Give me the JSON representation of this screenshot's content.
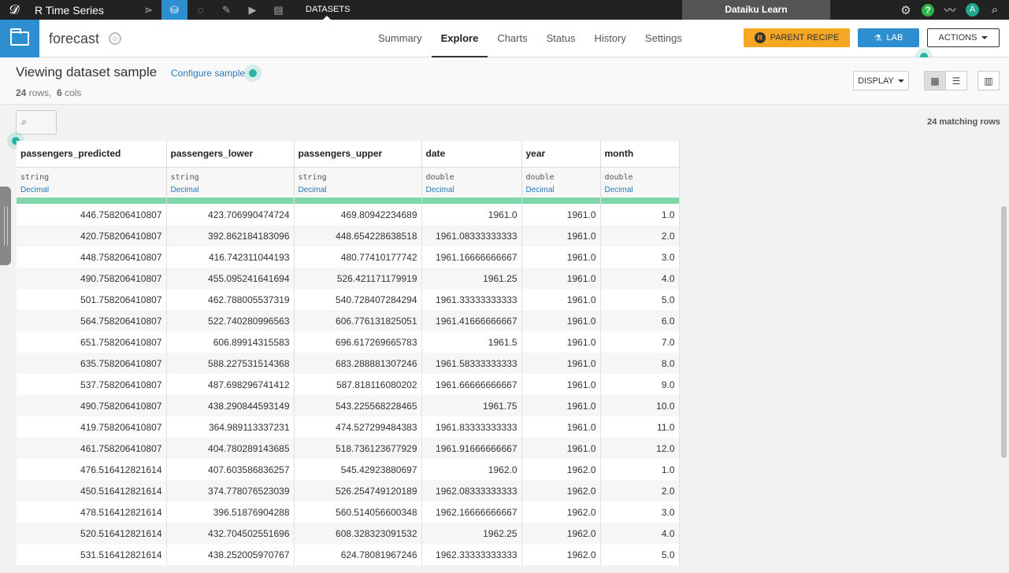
{
  "topnav": {
    "project_name": "R Time Series",
    "section": "DATASETS",
    "learn_label": "Dataiku Learn",
    "avatar_initial": "A",
    "help_label": "?"
  },
  "header": {
    "dataset_name": "forecast",
    "tabs": [
      "Summary",
      "Explore",
      "Charts",
      "Status",
      "History",
      "Settings"
    ],
    "active_tab": "Explore",
    "parent_recipe_label": "PARENT RECIPE",
    "lab_label": "LAB",
    "actions_label": "ACTIONS"
  },
  "subheader": {
    "title": "Viewing dataset sample",
    "configure_label": "Configure sample",
    "rows_count": "24",
    "rows_label": "rows,",
    "cols_count": "6",
    "cols_label": "cols",
    "display_label": "DISPLAY"
  },
  "table": {
    "matching_rows": "24 matching rows",
    "columns": [
      {
        "name": "passengers_predicted",
        "storage_type": "string",
        "meaning": "Decimal"
      },
      {
        "name": "passengers_lower",
        "storage_type": "string",
        "meaning": "Decimal"
      },
      {
        "name": "passengers_upper",
        "storage_type": "string",
        "meaning": "Decimal"
      },
      {
        "name": "date",
        "storage_type": "double",
        "meaning": "Decimal"
      },
      {
        "name": "year",
        "storage_type": "double",
        "meaning": "Decimal"
      },
      {
        "name": "month",
        "storage_type": "double",
        "meaning": "Decimal"
      }
    ],
    "rows": [
      [
        "446.758206410807",
        "423.706990474724",
        "469.80942234689",
        "1961.0",
        "1961.0",
        "1.0"
      ],
      [
        "420.758206410807",
        "392.862184183096",
        "448.654228638518",
        "1961.08333333333",
        "1961.0",
        "2.0"
      ],
      [
        "448.758206410807",
        "416.742311044193",
        "480.77410177742",
        "1961.16666666667",
        "1961.0",
        "3.0"
      ],
      [
        "490.758206410807",
        "455.095241641694",
        "526.421171179919",
        "1961.25",
        "1961.0",
        "4.0"
      ],
      [
        "501.758206410807",
        "462.788005537319",
        "540.728407284294",
        "1961.33333333333",
        "1961.0",
        "5.0"
      ],
      [
        "564.758206410807",
        "522.740280996563",
        "606.776131825051",
        "1961.41666666667",
        "1961.0",
        "6.0"
      ],
      [
        "651.758206410807",
        "606.89914315583",
        "696.617269665783",
        "1961.5",
        "1961.0",
        "7.0"
      ],
      [
        "635.758206410807",
        "588.227531514368",
        "683.288881307246",
        "1961.58333333333",
        "1961.0",
        "8.0"
      ],
      [
        "537.758206410807",
        "487.698296741412",
        "587.818116080202",
        "1961.66666666667",
        "1961.0",
        "9.0"
      ],
      [
        "490.758206410807",
        "438.290844593149",
        "543.225568228465",
        "1961.75",
        "1961.0",
        "10.0"
      ],
      [
        "419.758206410807",
        "364.989113337231",
        "474.527299484383",
        "1961.83333333333",
        "1961.0",
        "11.0"
      ],
      [
        "461.758206410807",
        "404.780289143685",
        "518.736123677929",
        "1961.91666666667",
        "1961.0",
        "12.0"
      ],
      [
        "476.516412821614",
        "407.603586836257",
        "545.42923880697",
        "1962.0",
        "1962.0",
        "1.0"
      ],
      [
        "450.516412821614",
        "374.778076523039",
        "526.254749120189",
        "1962.08333333333",
        "1962.0",
        "2.0"
      ],
      [
        "478.516412821614",
        "396.51876904288",
        "560.514056600348",
        "1962.16666666667",
        "1962.0",
        "3.0"
      ],
      [
        "520.516412821614",
        "432.704502551696",
        "608.328323091532",
        "1962.25",
        "1962.0",
        "4.0"
      ],
      [
        "531.516412821614",
        "438.252005970767",
        "624.78081967246",
        "1962.33333333333",
        "1962.0",
        "5.0"
      ]
    ]
  }
}
